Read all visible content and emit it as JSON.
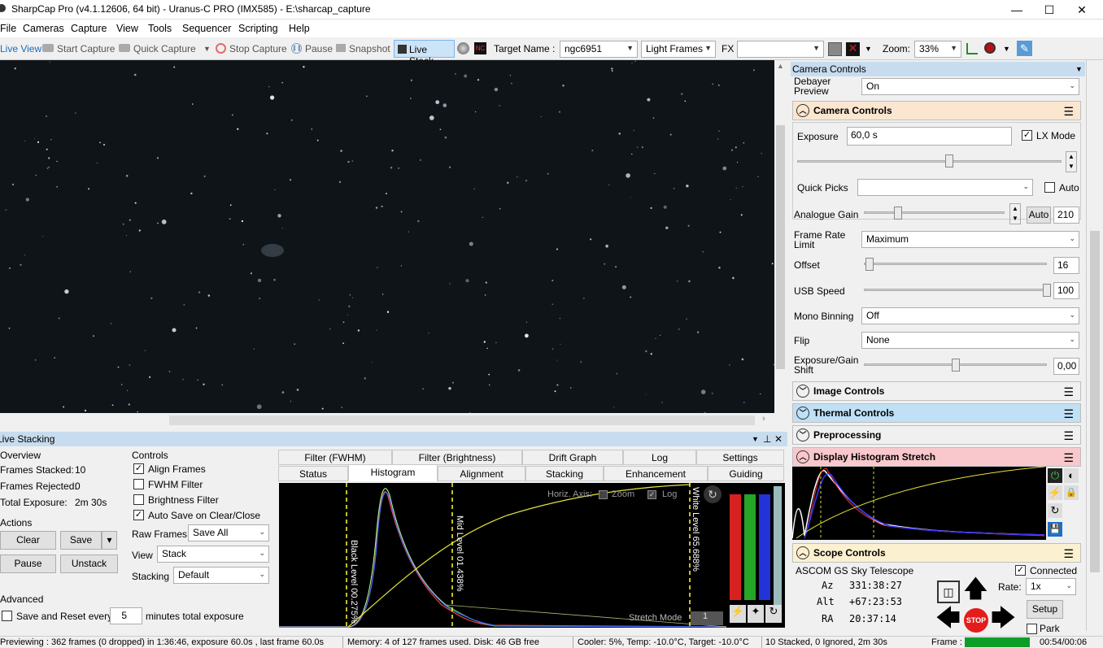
{
  "window": {
    "title": "SharpCap Pro (v4.1.12606, 64 bit) - Uranus-C PRO (IMX585) - E:\\sharcap_capture"
  },
  "menu": [
    "File",
    "Cameras",
    "Capture",
    "View",
    "Tools",
    "Sequencer",
    "Scripting",
    "Help"
  ],
  "toolbar": {
    "live_view": "Live View",
    "start_capture": "Start Capture",
    "quick_capture": "Quick Capture",
    "stop_capture": "Stop Capture",
    "pause": "Pause",
    "snapshot": "Snapshot",
    "live_stack": "Live Stack",
    "target_name_label": "Target Name :",
    "target_name_value": "ngc6951",
    "frame_type": "Light Frames",
    "fx_label": "FX",
    "fx_value": "",
    "zoom_label": "Zoom:",
    "zoom_value": "33%"
  },
  "live_stacking": {
    "title": "Live Stacking",
    "overview": {
      "heading": "Overview",
      "frames_stacked_label": "Frames Stacked:",
      "frames_stacked": "10",
      "frames_rejected_label": "Frames Rejected:",
      "frames_rejected": "0",
      "total_exposure_label": "Total Exposure:",
      "total_exposure": "2m 30s"
    },
    "actions": {
      "heading": "Actions",
      "clear": "Clear",
      "save": "Save",
      "pause": "Pause",
      "unstack": "Unstack"
    },
    "advanced": {
      "heading": "Advanced",
      "save_reset_label": "Save and Reset every",
      "save_reset_value": "5",
      "save_reset_suffix": "minutes total exposure"
    },
    "controls": {
      "heading": "Controls",
      "align_frames": "Align Frames",
      "fwhm_filter": "FWHM Filter",
      "brightness_filter": "Brightness Filter",
      "auto_save": "Auto Save on Clear/Close",
      "raw_frames_label": "Raw Frames",
      "raw_frames_value": "Save All",
      "view_label": "View",
      "view_value": "Stack",
      "stacking_label": "Stacking",
      "stacking_value": "Default"
    },
    "tabs_row1": [
      "Filter (FWHM)",
      "Filter (Brightness)",
      "Drift Graph",
      "Log",
      "Settings"
    ],
    "tabs_row2": [
      "Status",
      "Histogram",
      "Alignment",
      "Stacking",
      "Enhancement",
      "Guiding"
    ],
    "histogram": {
      "horiz_axis": "Horiz. Axis:",
      "zoom": "Zoom",
      "log": "Log",
      "black_level": "Black Level 00.275%",
      "mid_level": "Mid Level 01.438%",
      "white_level": "White Level 65.688%",
      "stretch_mode_label": "Stretch Mode",
      "stretch_mode_value": "1"
    }
  },
  "right_panel": {
    "title": "Camera Controls",
    "debayer_label": "Debayer Preview",
    "debayer_value": "On",
    "camera_controls": "Camera Controls",
    "exposure_label": "Exposure",
    "exposure_value": "60,0 s",
    "lx_mode": "LX Mode",
    "quick_picks_label": "Quick Picks",
    "auto_label": "Auto",
    "analogue_gain_label": "Analogue Gain",
    "analogue_gain_auto": "Auto",
    "analogue_gain_value": "210",
    "frame_rate_label": "Frame Rate Limit",
    "frame_rate_value": "Maximum",
    "offset_label": "Offset",
    "offset_value": "16",
    "usb_speed_label": "USB Speed",
    "usb_speed_value": "100",
    "mono_binning_label": "Mono Binning",
    "mono_binning_value": "Off",
    "flip_label": "Flip",
    "flip_value": "None",
    "exp_gain_shift_label": "Exposure/Gain Shift",
    "exp_gain_shift_value": "0,00",
    "image_controls": "Image Controls",
    "thermal_controls": "Thermal Controls",
    "preprocessing": "Preprocessing",
    "display_histogram": "Display Histogram Stretch",
    "scope_controls": "Scope Controls",
    "scope_name": "ASCOM GS Sky Telescope",
    "connected": "Connected",
    "az_label": "Az",
    "az_value": "331:38:27",
    "alt_label": "Alt",
    "alt_value": "+67:23:53",
    "ra_label": "RA",
    "ra_value": "20:37:14",
    "rate_label": "Rate:",
    "rate_value": "1x",
    "setup": "Setup",
    "park": "Park",
    "stop": "STOP"
  },
  "status": {
    "preview": "Previewing : 362 frames (0 dropped) in 1:36:46, exposure 60.0s , last frame 60.0s",
    "memory": "Memory: 4 of 127 frames used. Disk: 46 GB free",
    "cooler": "Cooler: 5%, Temp: -10.0°C, Target: -10.0°C",
    "stacked": "10 Stacked, 0 Ignored, 2m 30s",
    "frame_label": "Frame :",
    "time": "00:54/00:06"
  },
  "colors": {
    "accent": "#1a6bc4",
    "camera_header": "#fbe6d0",
    "thermal_header": "#bfe0f5",
    "histo_header": "#f8c8cc",
    "scope_header": "#fbf1d0",
    "panel_head": "#c7dcee"
  }
}
